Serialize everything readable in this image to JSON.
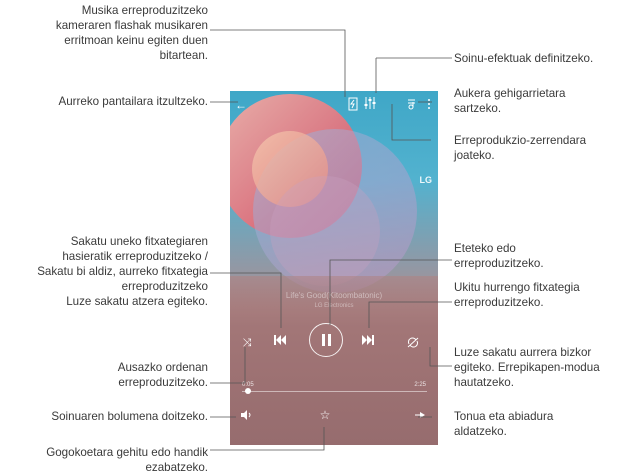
{
  "phone": {
    "song_title": "Life's Good(Kitoombatonic)",
    "song_artist": "LG Electronics",
    "logo": "LG",
    "time_elapsed": "0:05",
    "time_total": "2:25",
    "progress": 0.03
  },
  "annotations": {
    "flash": [
      "Musika erreproduzitzeko",
      "kameraren flashak musikaren",
      "erritmoan keinu egiten duen",
      "bitartean."
    ],
    "sound_effects": [
      "Soinu-efektuak definitzeko."
    ],
    "back": [
      "Aurreko pantailara itzultzeko."
    ],
    "more_options": [
      "Aukera gehigarrietara",
      "sartzeko."
    ],
    "playlist": [
      "Erreprodukzio-zerrendara",
      "joateko."
    ],
    "previous": [
      "Sakatu uneko fitxategiaren",
      "hasieratik erreproduzitzeko /",
      "Sakatu bi aldiz, aurreko fitxategia",
      "erreproduzitzeko",
      "Luze sakatu atzera egiteko."
    ],
    "play_pause": [
      "Eteteko edo",
      "erreproduzitzeko."
    ],
    "next": [
      "Ukitu hurrengo fitxategia",
      "erreproduzitzeko."
    ],
    "shuffle": [
      "Ausazko ordenan",
      "erreproduzitzeko."
    ],
    "repeat": [
      "Luze sakatu aurrera bizkor",
      "egiteko. Errepikapen-modua",
      "hautatzeko."
    ],
    "volume": [
      "Soinuaren bolumena doitzeko."
    ],
    "speed": [
      "Tonua eta abiadura",
      "aldatzeko."
    ],
    "favorite": [
      "Gogokoetara gehitu edo handik",
      "ezabatzeko."
    ]
  },
  "icons": {
    "back": "back-arrow-icon",
    "flash": "flash-icon",
    "effects": "equalizer-icon",
    "playlist": "playlist-icon",
    "more": "more-dots-icon",
    "shuffle": "shuffle-icon",
    "previous": "previous-icon",
    "play_pause": "pause-icon",
    "next": "next-icon",
    "repeat": "repeat-icon",
    "volume": "volume-icon",
    "favorite": "star-icon",
    "speed": "speed-icon"
  }
}
